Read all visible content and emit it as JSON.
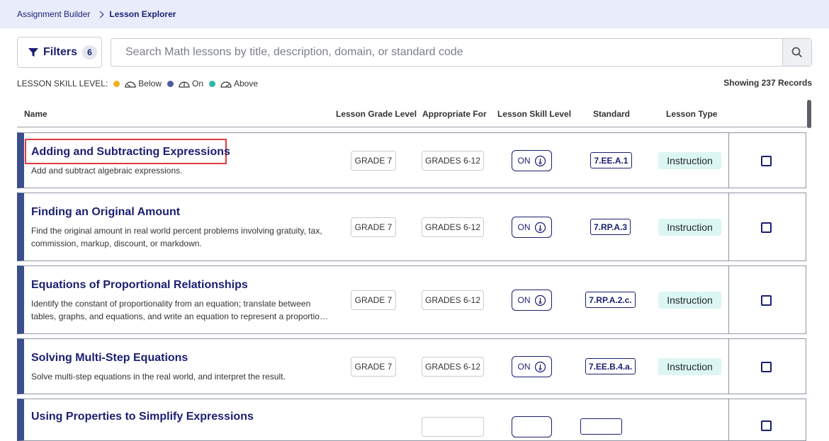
{
  "breadcrumb": {
    "parent": "Assignment Builder",
    "current": "Lesson Explorer"
  },
  "filters": {
    "label": "Filters",
    "count": "6"
  },
  "search": {
    "placeholder": "Search Math lessons by title, description, domain, or standard code",
    "value": ""
  },
  "legend": {
    "label": "LESSON SKILL LEVEL:",
    "items": [
      {
        "text": "Below",
        "color": "#f2b01e",
        "icon": "gauge-low-icon"
      },
      {
        "text": "On",
        "color": "#4c5f9e",
        "icon": "gauge-mid-icon"
      },
      {
        "text": "Above",
        "color": "#2bb8a2",
        "icon": "gauge-high-icon"
      }
    ]
  },
  "records": "Showing 237 Records",
  "columns": {
    "name": "Name",
    "grade": "Lesson Grade Level",
    "appropriate": "Appropriate For",
    "skill": "Lesson Skill Level",
    "standard": "Standard",
    "type": "Lesson Type"
  },
  "lessons": [
    {
      "title": "Adding and Subtracting Expressions",
      "description": "Add and subtract algebraic expressions.",
      "grade": "GRADE 7",
      "appropriate": "GRADES 6-12",
      "skill": "ON",
      "standard": "7.EE.A.1",
      "type": "Instruction"
    },
    {
      "title": "Finding an Original Amount",
      "description": "Find the original amount in real world percent problems involving gratuity, tax, commission, markup, discount, or markdown.",
      "grade": "GRADE 7",
      "appropriate": "GRADES 6-12",
      "skill": "ON",
      "standard": "7.RP.A.3",
      "type": "Instruction"
    },
    {
      "title": "Equations of Proportional Relationships",
      "description": "Identify the constant of proportionality from an equation; translate between tables, graphs, and equations, and write an equation to represent a proportional relationship.",
      "grade": "GRADE 7",
      "appropriate": "GRADES 6-12",
      "skill": "ON",
      "standard": "7.RP.A.2.c.",
      "type": "Instruction"
    },
    {
      "title": "Solving Multi-Step Equations",
      "description": "Solve multi-step equations in the real world, and interpret the result.",
      "grade": "GRADE 7",
      "appropriate": "GRADES 6-12",
      "skill": "ON",
      "standard": "7.EE.B.4.a.",
      "type": "Instruction"
    },
    {
      "title": "Using Properties to Simplify Expressions"
    }
  ]
}
